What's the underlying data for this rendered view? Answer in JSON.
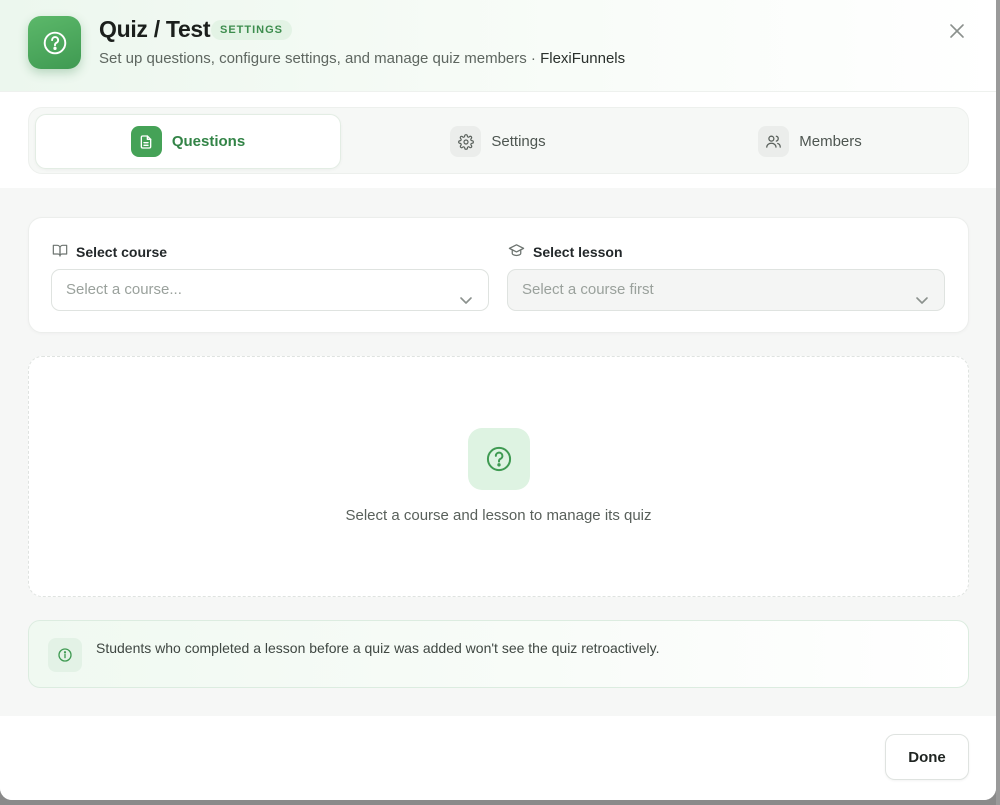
{
  "header": {
    "title": "Quiz / Test",
    "badge": "SETTINGS",
    "subtitle": "Set up questions, configure settings, and manage quiz members · ",
    "workspace": "FlexiFunnels",
    "app_icon": "question-circle-icon",
    "close_icon": "close-icon"
  },
  "tabs": [
    {
      "label": "Questions",
      "icon": "document-icon",
      "active": true
    },
    {
      "label": "Settings",
      "icon": "gear-icon",
      "active": false
    },
    {
      "label": "Members",
      "icon": "users-icon",
      "active": false
    }
  ],
  "selectors": {
    "course": {
      "label": "Select course",
      "icon": "book-icon",
      "placeholder": "Select a course..."
    },
    "lesson": {
      "label": "Select lesson",
      "icon": "graduation-cap-icon",
      "placeholder": "Select a course first"
    }
  },
  "empty_state": {
    "icon": "question-circle-icon",
    "text": "Select a course and lesson to manage its quiz"
  },
  "note": {
    "icon": "info-icon",
    "text": "Students who completed a lesson before a quiz was added won't see the quiz retroactively."
  },
  "footer": {
    "done_label": "Done"
  },
  "colors": {
    "accent": "#45a257",
    "accent_text": "#338447",
    "badge_bg": "#e3f3e5"
  }
}
